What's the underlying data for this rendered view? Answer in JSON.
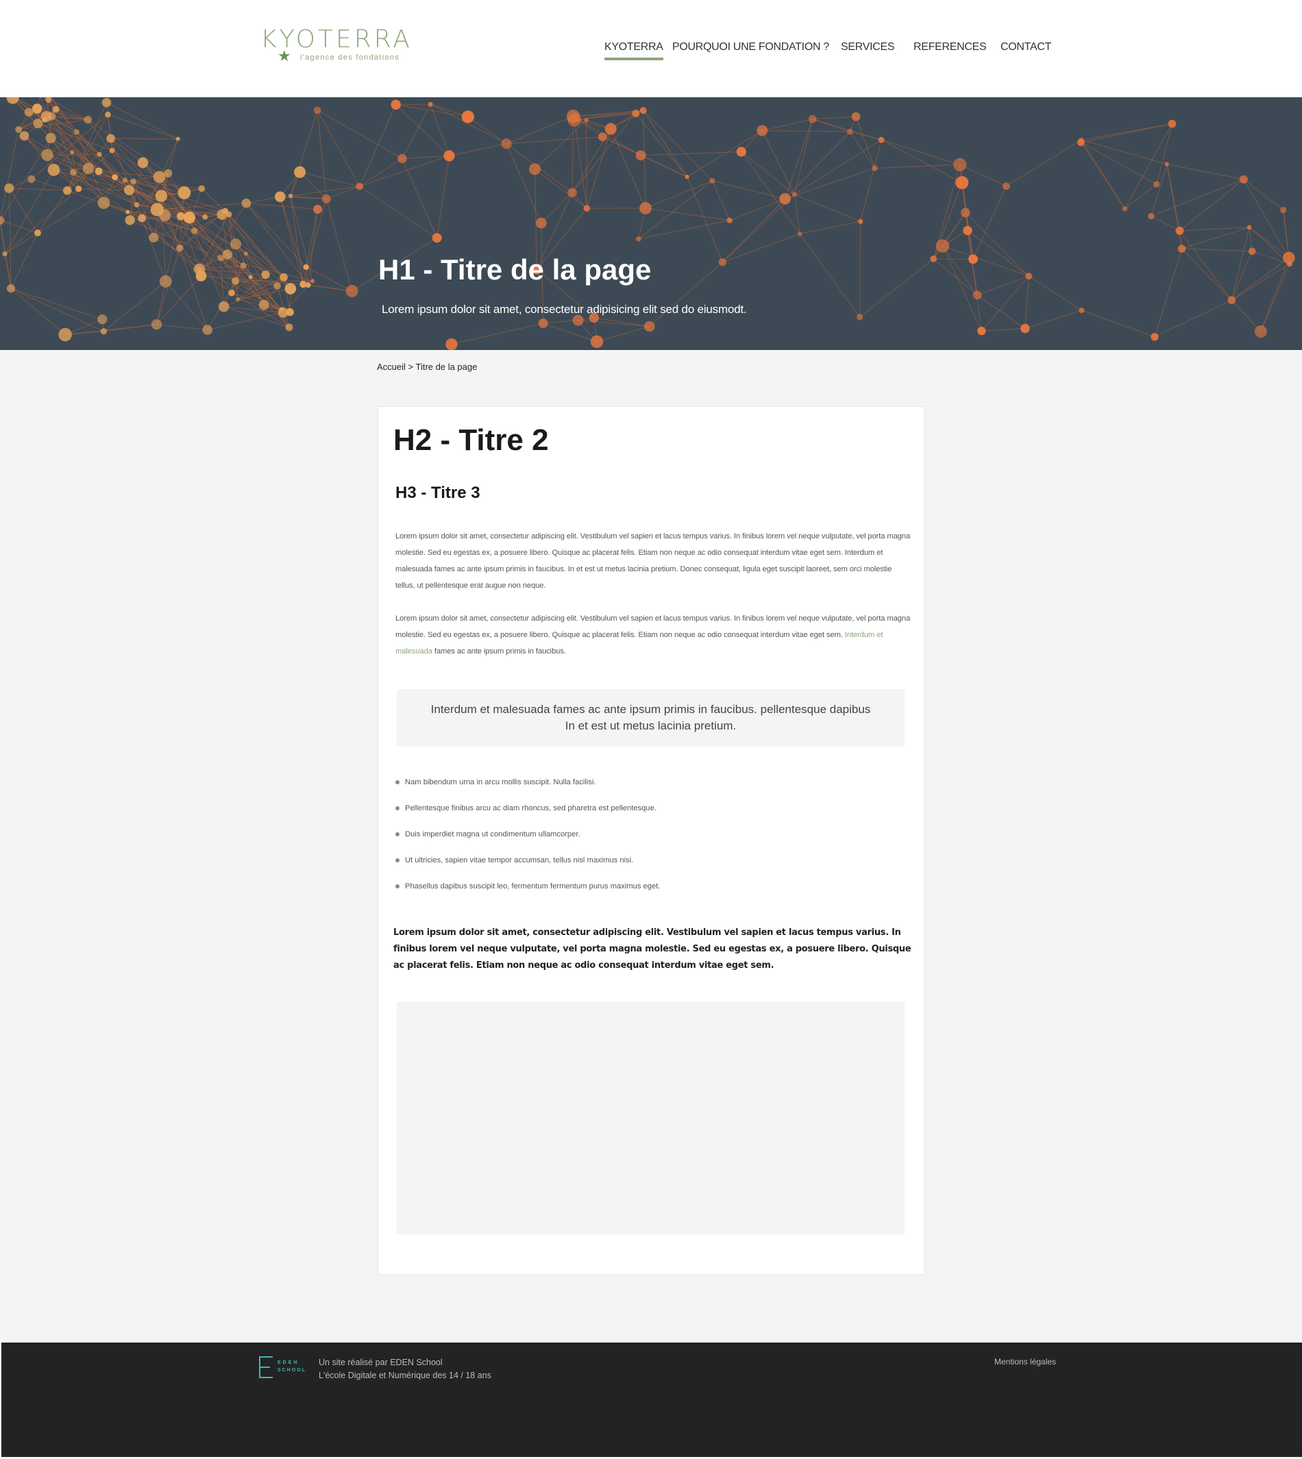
{
  "header": {
    "logo_word": "KYOTERRA",
    "logo_tagline": "l'agence des fondations",
    "nav": [
      {
        "label": "KYOTERRA",
        "active": true
      },
      {
        "label": "POURQUOI UNE FONDATION ?",
        "active": false
      },
      {
        "label": "SERVICES",
        "active": false
      },
      {
        "label": "REFERENCES",
        "active": false
      },
      {
        "label": "CONTACT",
        "active": false
      }
    ]
  },
  "hero": {
    "title": "H1 - Titre de la page",
    "subtitle": "Lorem ipsum dolor sit amet, consectetur adipisicing elit sed do eiusmodt."
  },
  "breadcrumb": "Accueil > Titre de la page",
  "content": {
    "h2": "H2 - Titre 2",
    "h3": "H3 - Titre 3",
    "para1": "Lorem ipsum dolor sit amet, consectetur adipiscing elit. Vestibulum vel sapien et lacus tempus varius. In finibus lorem vel neque vulputate, vel porta magna molestie. Sed eu egestas ex, a posuere libero. Quisque ac placerat felis. Etiam non neque ac odio consequat interdum vitae eget sem. Interdum et malesuada fames ac ante ipsum primis in faucibus. In et est ut metus lacinia pretium. Donec consequat, ligula eget suscipit laoreet, sem orci molestie tellus, ut pellentesque erat augue non neque.",
    "para2_before": "Lorem ipsum dolor sit amet, consectetur adipiscing elit. Vestibulum vel sapien et lacus tempus varius. In finibus lorem vel neque vulputate, vel porta magna molestie. Sed eu egestas ex, a posuere libero. Quisque ac placerat felis. Etiam non neque ac odio consequat interdum vitae eget sem. ",
    "para2_link": "Interdum et malesuada",
    "para2_after": " fames ac ante ipsum primis in faucibus.",
    "quote_line1": "Interdum et malesuada fames ac ante ipsum primis in faucibus. pellentesque dapibus",
    "quote_line2": "In et est ut metus lacinia pretium.",
    "bullets": [
      "Nam bibendum urna in arcu mollis suscipit. Nulla facilisi.",
      "Pellentesque finibus arcu ac diam rhoncus, sed pharetra est pellentesque.",
      "Duis imperdiet magna ut condimentum ullamcorper.",
      "Ut ultricies, sapien vitae tempor accumsan, tellus nisl maximus nisi.",
      "Phasellus dapibus suscipit leo, fermentum fermentum purus maximus eget."
    ],
    "bold_para": "Lorem ipsum dolor sit amet, consectetur adipiscing elit. Vestibulum vel sapien et lacus tempus varius. In finibus lorem vel neque vulputate, vel porta magna molestie. Sed eu egestas ex, a posuere libero. Quisque ac placerat felis. Etiam non neque ac odio consequat interdum vitae eget sem."
  },
  "footer": {
    "eden_line1": "EDEN",
    "eden_line2": "SCHOOL",
    "credit_line1": "Un site réalisé par EDEN School",
    "credit_line2": "L'école Digitale et Numérique des 14 / 18 ans",
    "legal": "Mentions légales"
  },
  "colors": {
    "accent": "#8fa67a",
    "hero_bg": "#3d4a55",
    "node": "#e8773f",
    "footer_bg": "#232323",
    "eden": "#3fb8b0"
  }
}
